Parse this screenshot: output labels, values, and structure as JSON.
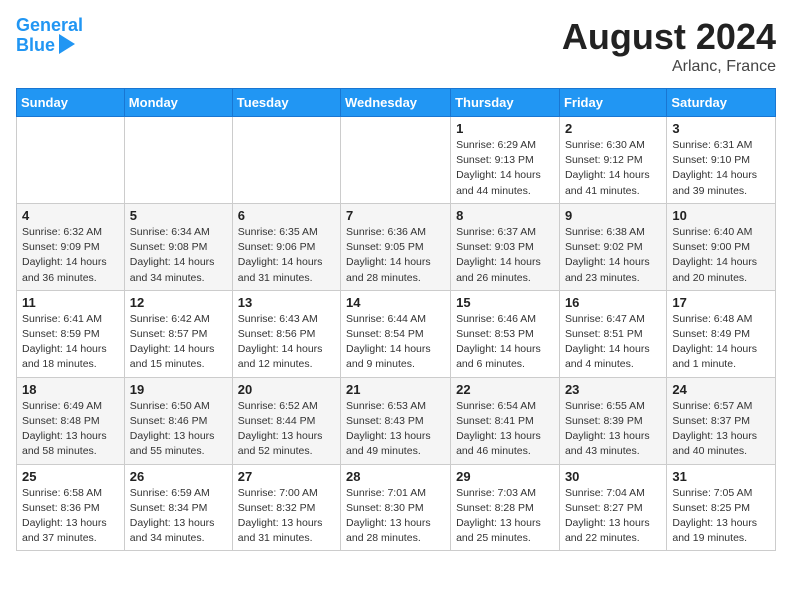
{
  "header": {
    "logo_line1": "General",
    "logo_line2": "Blue",
    "month": "August 2024",
    "location": "Arlanc, France"
  },
  "days_of_week": [
    "Sunday",
    "Monday",
    "Tuesday",
    "Wednesday",
    "Thursday",
    "Friday",
    "Saturday"
  ],
  "weeks": [
    [
      {
        "num": "",
        "info": ""
      },
      {
        "num": "",
        "info": ""
      },
      {
        "num": "",
        "info": ""
      },
      {
        "num": "",
        "info": ""
      },
      {
        "num": "1",
        "info": "Sunrise: 6:29 AM\nSunset: 9:13 PM\nDaylight: 14 hours\nand 44 minutes."
      },
      {
        "num": "2",
        "info": "Sunrise: 6:30 AM\nSunset: 9:12 PM\nDaylight: 14 hours\nand 41 minutes."
      },
      {
        "num": "3",
        "info": "Sunrise: 6:31 AM\nSunset: 9:10 PM\nDaylight: 14 hours\nand 39 minutes."
      }
    ],
    [
      {
        "num": "4",
        "info": "Sunrise: 6:32 AM\nSunset: 9:09 PM\nDaylight: 14 hours\nand 36 minutes."
      },
      {
        "num": "5",
        "info": "Sunrise: 6:34 AM\nSunset: 9:08 PM\nDaylight: 14 hours\nand 34 minutes."
      },
      {
        "num": "6",
        "info": "Sunrise: 6:35 AM\nSunset: 9:06 PM\nDaylight: 14 hours\nand 31 minutes."
      },
      {
        "num": "7",
        "info": "Sunrise: 6:36 AM\nSunset: 9:05 PM\nDaylight: 14 hours\nand 28 minutes."
      },
      {
        "num": "8",
        "info": "Sunrise: 6:37 AM\nSunset: 9:03 PM\nDaylight: 14 hours\nand 26 minutes."
      },
      {
        "num": "9",
        "info": "Sunrise: 6:38 AM\nSunset: 9:02 PM\nDaylight: 14 hours\nand 23 minutes."
      },
      {
        "num": "10",
        "info": "Sunrise: 6:40 AM\nSunset: 9:00 PM\nDaylight: 14 hours\nand 20 minutes."
      }
    ],
    [
      {
        "num": "11",
        "info": "Sunrise: 6:41 AM\nSunset: 8:59 PM\nDaylight: 14 hours\nand 18 minutes."
      },
      {
        "num": "12",
        "info": "Sunrise: 6:42 AM\nSunset: 8:57 PM\nDaylight: 14 hours\nand 15 minutes."
      },
      {
        "num": "13",
        "info": "Sunrise: 6:43 AM\nSunset: 8:56 PM\nDaylight: 14 hours\nand 12 minutes."
      },
      {
        "num": "14",
        "info": "Sunrise: 6:44 AM\nSunset: 8:54 PM\nDaylight: 14 hours\nand 9 minutes."
      },
      {
        "num": "15",
        "info": "Sunrise: 6:46 AM\nSunset: 8:53 PM\nDaylight: 14 hours\nand 6 minutes."
      },
      {
        "num": "16",
        "info": "Sunrise: 6:47 AM\nSunset: 8:51 PM\nDaylight: 14 hours\nand 4 minutes."
      },
      {
        "num": "17",
        "info": "Sunrise: 6:48 AM\nSunset: 8:49 PM\nDaylight: 14 hours\nand 1 minute."
      }
    ],
    [
      {
        "num": "18",
        "info": "Sunrise: 6:49 AM\nSunset: 8:48 PM\nDaylight: 13 hours\nand 58 minutes."
      },
      {
        "num": "19",
        "info": "Sunrise: 6:50 AM\nSunset: 8:46 PM\nDaylight: 13 hours\nand 55 minutes."
      },
      {
        "num": "20",
        "info": "Sunrise: 6:52 AM\nSunset: 8:44 PM\nDaylight: 13 hours\nand 52 minutes."
      },
      {
        "num": "21",
        "info": "Sunrise: 6:53 AM\nSunset: 8:43 PM\nDaylight: 13 hours\nand 49 minutes."
      },
      {
        "num": "22",
        "info": "Sunrise: 6:54 AM\nSunset: 8:41 PM\nDaylight: 13 hours\nand 46 minutes."
      },
      {
        "num": "23",
        "info": "Sunrise: 6:55 AM\nSunset: 8:39 PM\nDaylight: 13 hours\nand 43 minutes."
      },
      {
        "num": "24",
        "info": "Sunrise: 6:57 AM\nSunset: 8:37 PM\nDaylight: 13 hours\nand 40 minutes."
      }
    ],
    [
      {
        "num": "25",
        "info": "Sunrise: 6:58 AM\nSunset: 8:36 PM\nDaylight: 13 hours\nand 37 minutes."
      },
      {
        "num": "26",
        "info": "Sunrise: 6:59 AM\nSunset: 8:34 PM\nDaylight: 13 hours\nand 34 minutes."
      },
      {
        "num": "27",
        "info": "Sunrise: 7:00 AM\nSunset: 8:32 PM\nDaylight: 13 hours\nand 31 minutes."
      },
      {
        "num": "28",
        "info": "Sunrise: 7:01 AM\nSunset: 8:30 PM\nDaylight: 13 hours\nand 28 minutes."
      },
      {
        "num": "29",
        "info": "Sunrise: 7:03 AM\nSunset: 8:28 PM\nDaylight: 13 hours\nand 25 minutes."
      },
      {
        "num": "30",
        "info": "Sunrise: 7:04 AM\nSunset: 8:27 PM\nDaylight: 13 hours\nand 22 minutes."
      },
      {
        "num": "31",
        "info": "Sunrise: 7:05 AM\nSunset: 8:25 PM\nDaylight: 13 hours\nand 19 minutes."
      }
    ]
  ]
}
